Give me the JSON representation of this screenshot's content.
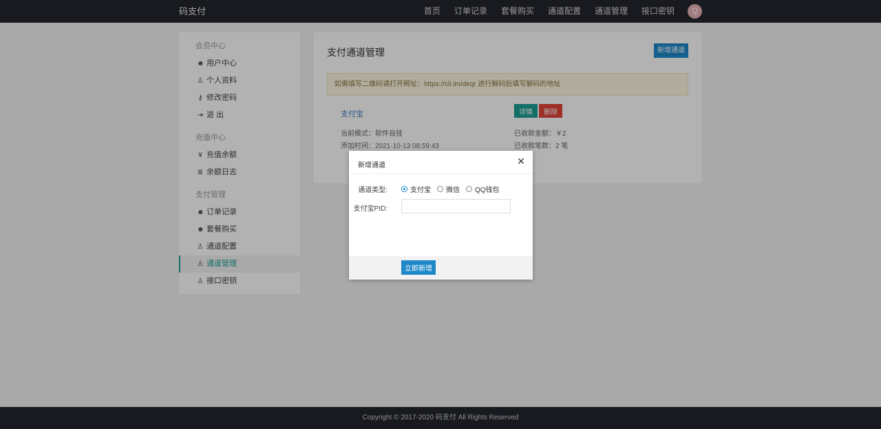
{
  "brand": "码支付",
  "nav": [
    "首页",
    "订单记录",
    "套餐购买",
    "通道配置",
    "通道管理",
    "接口密钥"
  ],
  "avatar_letter": "Q",
  "sidebar": {
    "groups": [
      {
        "title": "会员中心",
        "items": [
          {
            "label": "用户中心",
            "icon": "user-circle-icon",
            "glyph": "☻"
          },
          {
            "label": "个人资料",
            "icon": "person-icon",
            "glyph": "♙"
          },
          {
            "label": "修改密码",
            "icon": "key-icon",
            "glyph": "⚷"
          },
          {
            "label": "退 出",
            "icon": "logout-icon",
            "glyph": "⇥"
          }
        ]
      },
      {
        "title": "充值中心",
        "items": [
          {
            "label": "充值余额",
            "icon": "yen-icon",
            "glyph": "¥"
          },
          {
            "label": "余额日志",
            "icon": "list-icon",
            "glyph": "≣"
          }
        ]
      },
      {
        "title": "支付管理",
        "items": [
          {
            "label": "订单记录",
            "icon": "user-circle-icon",
            "glyph": "☻"
          },
          {
            "label": "套餐购买",
            "icon": "user-circle-icon",
            "glyph": "☻"
          },
          {
            "label": "通道配置",
            "icon": "person-icon",
            "glyph": "♙"
          },
          {
            "label": "通道管理",
            "icon": "person-icon",
            "glyph": "♙",
            "active": true
          },
          {
            "label": "接口密钥",
            "icon": "person-icon",
            "glyph": "♙"
          }
        ]
      }
    ]
  },
  "main": {
    "title": "支付通道管理",
    "new_button": "新增通道",
    "notice": "如需填写二维码请打开网址：https://cli.im/deqr 进行解码后填写解码的地址",
    "channel": {
      "name": "支付宝",
      "detail_button": "详情",
      "delete_button": "删除",
      "mode": "当前模式：软件自挂",
      "added": "添加时间：2021-10-13 08:59:43",
      "received_amount": "已收款金额：￥2",
      "received_count": "已收款笔数：2 笔"
    }
  },
  "modal": {
    "title": "新增通道",
    "close_glyph": "✕",
    "type_label": "通道类型:",
    "options": [
      "支付宝",
      "微信",
      "QQ钱包"
    ],
    "selected": 0,
    "pid_label": "支付宝PID:",
    "pid_value": "",
    "pid_placeholder": "",
    "submit": "立即新增"
  },
  "footer": "Copyright © 2017-2020 码支付 All Rights Reserved",
  "colors": {
    "topbar": "#23262e",
    "accent_green": "#1aa094",
    "accent_blue": "#1e88c9",
    "danger": "#e0443a"
  }
}
